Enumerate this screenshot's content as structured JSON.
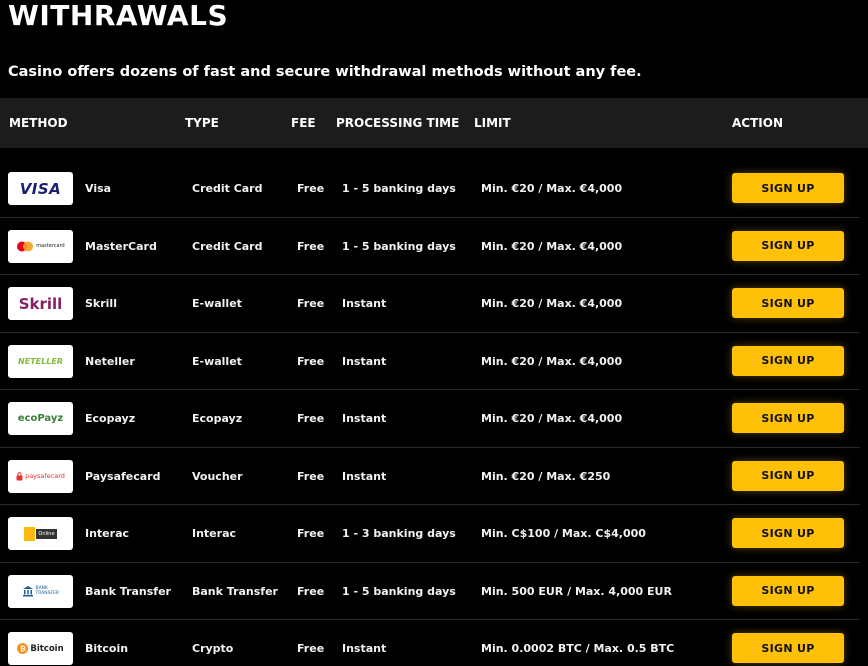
{
  "page": {
    "title": "WITHRAWALS",
    "subtitle": "Casino offers dozens of fast and secure withdrawal methods without any fee."
  },
  "table": {
    "headers": {
      "method": "METHOD",
      "type": "TYPE",
      "fee": "FEE",
      "processing": "PROCESSING TIME",
      "limit": "LIMIT",
      "action": "ACTION"
    },
    "rows": [
      {
        "logo": "visa-logo",
        "logo_text": "VISA",
        "method": "Visa",
        "type": "Credit Card",
        "fee": "Free",
        "time": "1 - 5 banking days",
        "limit": "Min. €20 / Max. €4,000",
        "action": "SIGN UP"
      },
      {
        "logo": "mastercard-logo",
        "logo_text": "mastercard",
        "method": "MasterCard",
        "type": "Credit Card",
        "fee": "Free",
        "time": "1 - 5 banking days",
        "limit": "Min. €20 / Max. €4,000",
        "action": "SIGN UP"
      },
      {
        "logo": "skrill-logo",
        "logo_text": "Skrill",
        "method": "Skrill",
        "type": "E-wallet",
        "fee": "Free",
        "time": "Instant",
        "limit": "Min. €20 / Max. €4,000",
        "action": "SIGN UP"
      },
      {
        "logo": "neteller-logo",
        "logo_text": "NETELLER",
        "method": "Neteller",
        "type": "E-wallet",
        "fee": "Free",
        "time": "Instant",
        "limit": "Min. €20 / Max. €4,000",
        "action": "SIGN UP"
      },
      {
        "logo": "ecopayz-logo",
        "logo_text": "ecoPayz",
        "method": "Ecopayz",
        "type": "Ecopayz",
        "fee": "Free",
        "time": "Instant",
        "limit": "Min. €20 / Max. €4,000",
        "action": "SIGN UP"
      },
      {
        "logo": "paysafecard-logo",
        "logo_text": "paysafecard",
        "method": "Paysafecard",
        "type": "Voucher",
        "fee": "Free",
        "time": "Instant",
        "limit": "Min. €20 / Max. €250",
        "action": "SIGN UP"
      },
      {
        "logo": "interac-logo",
        "logo_text": "Online",
        "method": "Interac",
        "type": "Interac",
        "fee": "Free",
        "time": "1 - 3 banking days",
        "limit": "Min. C$100 / Max. C$4,000",
        "action": "SIGN UP"
      },
      {
        "logo": "bank-transfer-logo",
        "logo_text": "BANK TRANSFER",
        "method": "Bank Transfer",
        "type": "Bank Transfer",
        "fee": "Free",
        "time": "1 - 5 banking days",
        "limit": "Min. 500 EUR / Max. 4,000 EUR",
        "action": "SIGN UP"
      },
      {
        "logo": "bitcoin-logo",
        "logo_text": "Bitcoin",
        "method": "Bitcoin",
        "type": "Crypto",
        "fee": "Free",
        "time": "Instant",
        "limit": "Min. 0.0002 BTC / Max. 0.5 BTC",
        "action": "SIGN UP"
      }
    ]
  },
  "colors": {
    "background": "#000000",
    "header_bg": "#1c1c1c",
    "accent": "#ffc107",
    "row_divider": "#2a2a2a"
  }
}
